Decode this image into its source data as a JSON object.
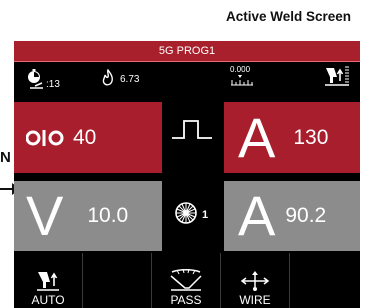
{
  "caption": "Active Weld Screen",
  "side_letter": "N",
  "program": {
    "title": "5G PROG1"
  },
  "status": {
    "timer_value": ":13",
    "heat_value": "6.73",
    "gauge_value": "0.000",
    "icons": [
      "stopwatch-icon",
      "flame-icon",
      "gauge-scale-icon",
      "torch-feed-icon"
    ]
  },
  "params": {
    "oscillation": {
      "value": "40",
      "icon": "oscillation-icon"
    },
    "amps_set": {
      "symbol": "A",
      "value": "130"
    },
    "volts": {
      "symbol": "V",
      "value": "10.0"
    },
    "amps_actual": {
      "symbol": "A",
      "value": "90.2"
    },
    "pulse_icon": "pulse-waveform-icon",
    "rotation": {
      "value": "1",
      "icon": "rotation-wheel-icon"
    }
  },
  "tabs": [
    {
      "label": "AUTO",
      "icon": "torch-feed-icon"
    },
    {
      "label": "",
      "icon": ""
    },
    {
      "label": "PASS",
      "icon": "weld-pass-icon"
    },
    {
      "label": "WIRE",
      "icon": "wire-direction-icon"
    },
    {
      "label": "",
      "icon": ""
    }
  ],
  "colors": {
    "red": "#a81e2d",
    "gray": "#8c8c8c",
    "screen_bg": "#000000"
  }
}
